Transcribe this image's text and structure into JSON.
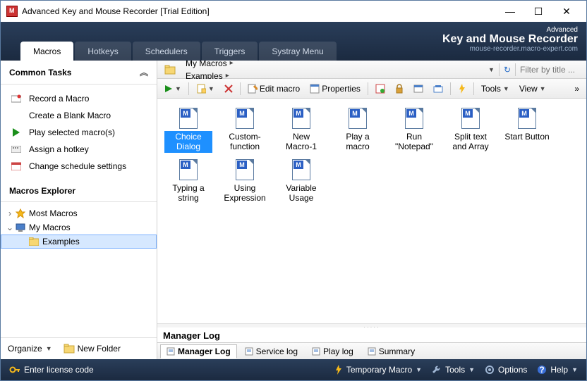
{
  "window": {
    "title": "Advanced Key and Mouse Recorder [Trial Edition]"
  },
  "brand": {
    "line1": "Advanced",
    "line2": "Key and Mouse Recorder",
    "line3": "mouse-recorder.macro-expert.com"
  },
  "tabs": [
    "Macros",
    "Hotkeys",
    "Schedulers",
    "Triggers",
    "Systray Menu"
  ],
  "active_tab": 0,
  "common_tasks": {
    "header": "Common Tasks",
    "items": [
      {
        "icon": "record",
        "label": "Record a Macro"
      },
      {
        "icon": "blank",
        "label": "Create a Blank Macro"
      },
      {
        "icon": "play",
        "label": "Play selected macro(s)"
      },
      {
        "icon": "hotkey",
        "label": "Assign a hotkey"
      },
      {
        "icon": "schedule",
        "label": "Change schedule settings"
      }
    ]
  },
  "explorer": {
    "header": "Macros Explorer",
    "tree": [
      {
        "arrow": "›",
        "icon": "star",
        "label": "Most Macros",
        "depth": 0
      },
      {
        "arrow": "⌄",
        "icon": "computer",
        "label": "My Macros",
        "depth": 0
      },
      {
        "arrow": "",
        "icon": "folder",
        "label": "Examples",
        "depth": 1,
        "selected": true
      }
    ]
  },
  "sidebar_footer": {
    "organize": "Organize",
    "new_folder": "New Folder"
  },
  "breadcrumb": {
    "segments": [
      "My Macros",
      "Examples"
    ],
    "filter_placeholder": "Filter by title ..."
  },
  "toolbar": {
    "edit_macro": "Edit macro",
    "properties": "Properties",
    "tools": "Tools",
    "view": "View"
  },
  "macros": [
    {
      "label": "Choice Dialog",
      "selected": true
    },
    {
      "label": "Custom-function"
    },
    {
      "label": "New Macro-1"
    },
    {
      "label": "Play a macro"
    },
    {
      "label": "Run \"Notepad\""
    },
    {
      "label": "Split text and Array"
    },
    {
      "label": "Start Button"
    },
    {
      "label": "Typing a string"
    },
    {
      "label": "Using Expression"
    },
    {
      "label": "Variable Usage"
    }
  ],
  "log": {
    "header": "Manager Log",
    "tabs": [
      "Manager Log",
      "Service log",
      "Play log",
      "Summary"
    ],
    "active": 0
  },
  "statusbar": {
    "license": "Enter license code",
    "temp_macro": "Temporary Macro",
    "tools": "Tools",
    "options": "Options",
    "help": "Help"
  }
}
